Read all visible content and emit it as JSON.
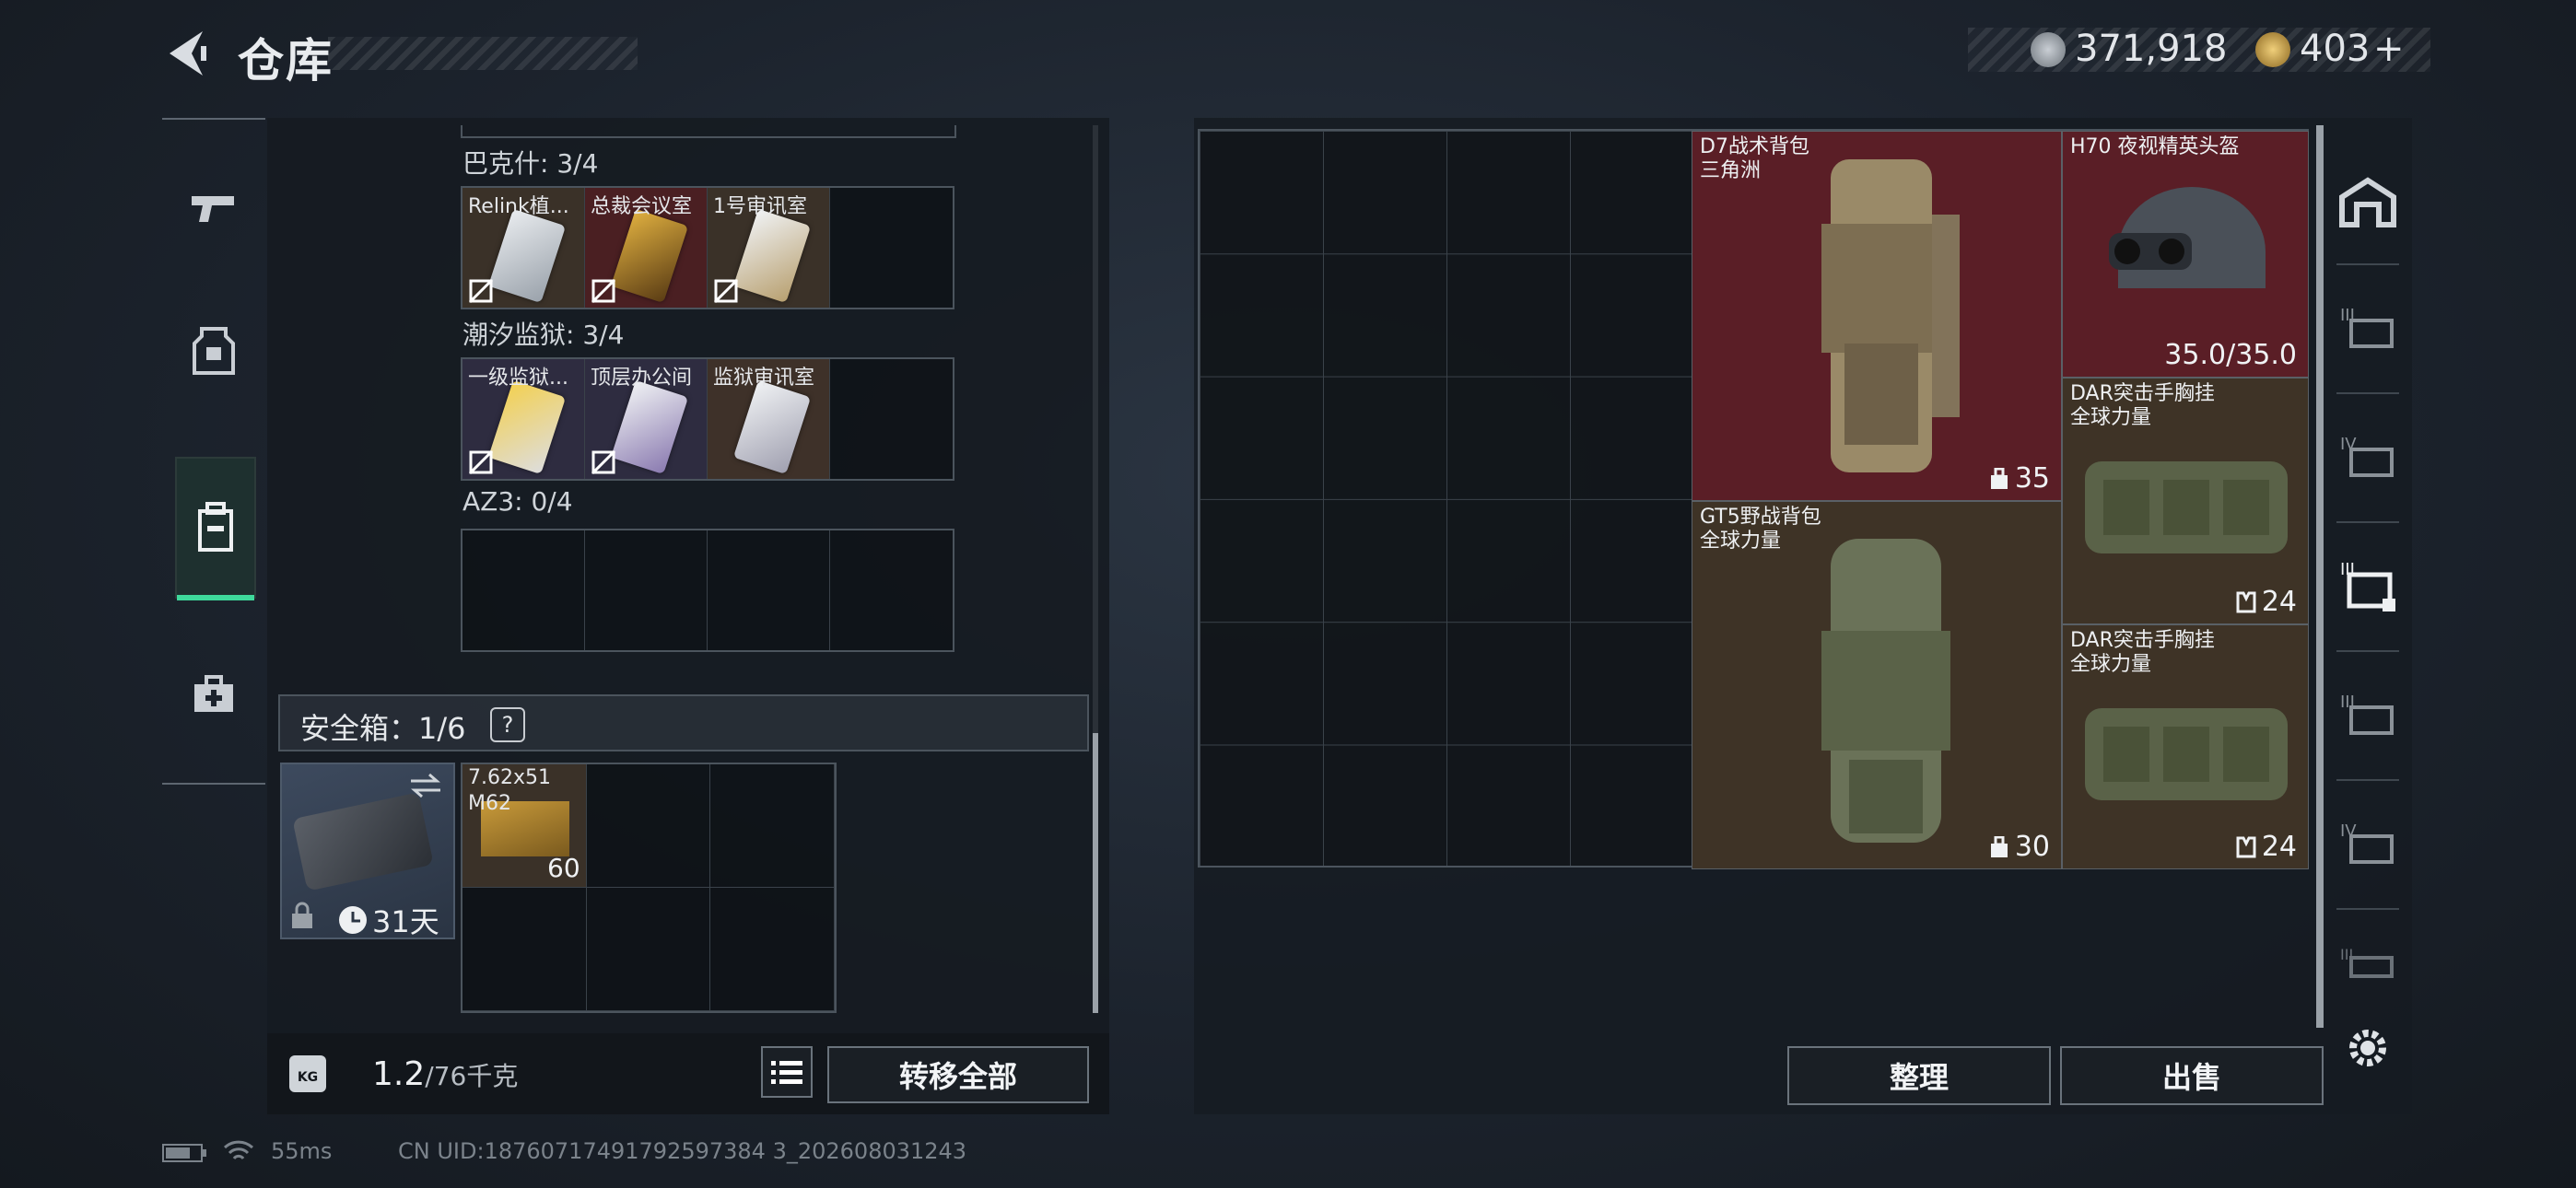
{
  "header": {
    "title": "仓库",
    "currency_silver": "371,918",
    "currency_gold": "403",
    "add_label": "+"
  },
  "sidebar_tabs": [
    {
      "name": "weapon",
      "active": false
    },
    {
      "name": "armor",
      "active": false
    },
    {
      "name": "backpack",
      "active": true
    },
    {
      "name": "medkit",
      "active": false
    }
  ],
  "left": {
    "sections": [
      {
        "label": "巴克什: 3/4",
        "items": [
          "Relink植...",
          "总裁会议室",
          "1号审讯室"
        ]
      },
      {
        "label": "潮汐监狱: 3/4",
        "items": [
          "一级监狱...",
          "顶层办公间",
          "监狱审讯室"
        ]
      },
      {
        "label": "AZ3: 0/4",
        "items": []
      }
    ],
    "safe_box": {
      "label": "安全箱：1/6",
      "help": "?",
      "days": "31天",
      "ammo_name_1": "7.62x51",
      "ammo_name_2": "M62",
      "ammo_count": "60"
    },
    "weight": {
      "value": "1.2",
      "unit": "/76千克",
      "kg_icon_text": "KG"
    },
    "transfer_all": "转移全部"
  },
  "storage": {
    "items": [
      {
        "name1": "D7战术背包",
        "name2": "三角洲",
        "badge": "35"
      },
      {
        "name1": "H70 夜视精英头盔",
        "name2": "",
        "badge": "35.0/35.0"
      },
      {
        "name1": "DAR突击手胸挂",
        "name2": "全球力量",
        "badge": "24"
      },
      {
        "name1": "GT5野战背包",
        "name2": "全球力量",
        "badge": "30"
      },
      {
        "name1": "DAR突击手胸挂",
        "name2": "全球力量",
        "badge": "24"
      }
    ],
    "sort_label": "整理",
    "sell_label": "出售"
  },
  "status": {
    "ping": "55ms",
    "uid": "CN UID:18760717491792597384 3_202608031243"
  },
  "colors": {
    "accent": "#3ed99b",
    "red_bg": "#5a1e26",
    "brown_bg": "#3e3326"
  }
}
